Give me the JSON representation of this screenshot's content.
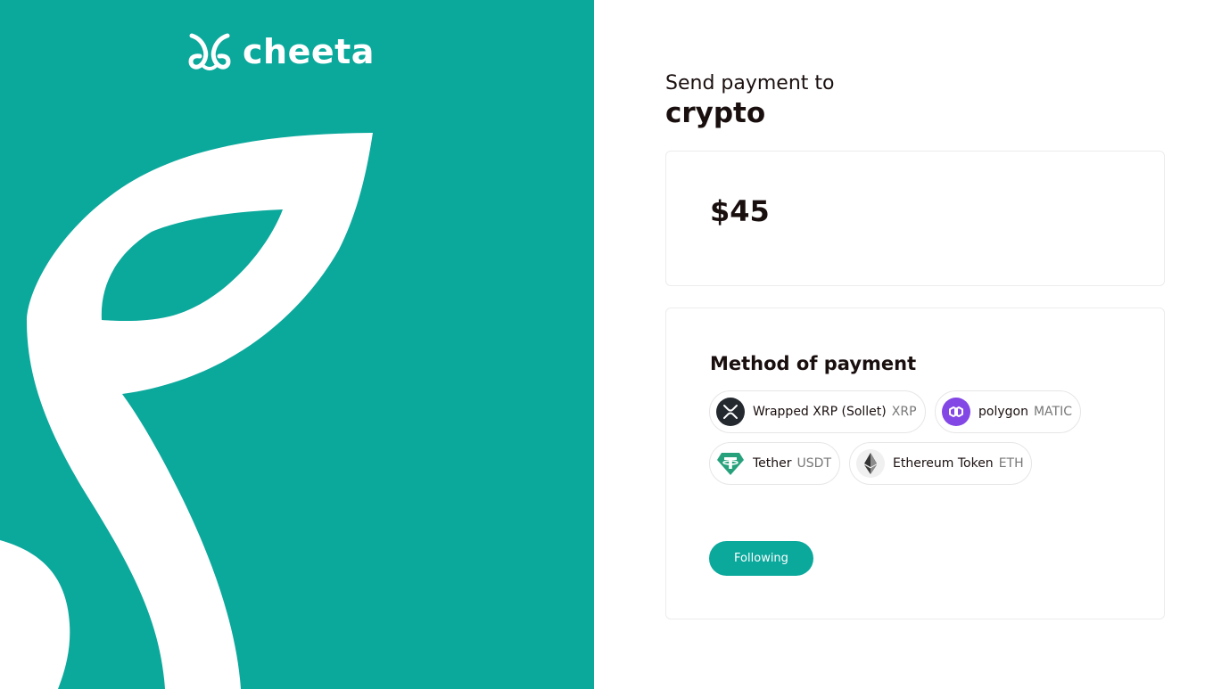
{
  "brand": {
    "name": "cheeta",
    "accent_color": "#0ba89c"
  },
  "header": {
    "subtitle": "Send payment to",
    "title": "crypto"
  },
  "amount": {
    "value": "$45"
  },
  "payment": {
    "title": "Method of payment",
    "tokens": [
      {
        "name": "Wrapped XRP (Sollet)",
        "symbol": "XRP",
        "icon": "xrp-icon"
      },
      {
        "name": "polygon",
        "symbol": "MATIC",
        "icon": "polygon-icon"
      },
      {
        "name": "Tether",
        "symbol": "USDT",
        "icon": "tether-icon"
      },
      {
        "name": "Ethereum Token",
        "symbol": "ETH",
        "icon": "ethereum-icon"
      }
    ],
    "next_label": "Following"
  }
}
